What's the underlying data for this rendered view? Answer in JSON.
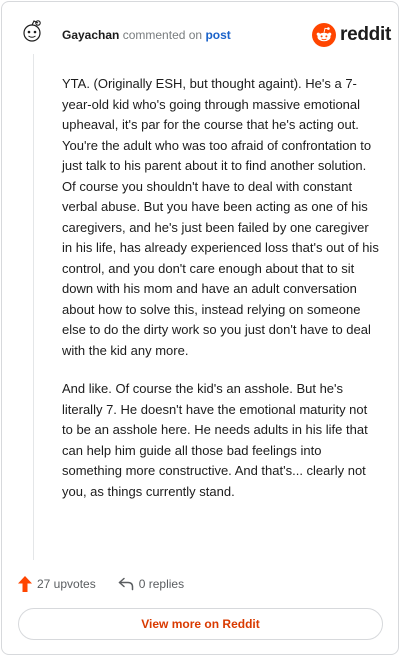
{
  "comment": {
    "username": "Gayachan",
    "commented_text": "commented on",
    "post_link": "post",
    "paragraphs": [
      "YTA. (Originally ESH, but thought againt). He's a 7-year-old kid who's going through massive emotional upheaval, it's par for the course that he's acting out. You're the adult who was too afraid of confrontation to just talk to his parent about it to find another solution. Of course you shouldn't have to deal with constant verbal abuse. But you have been acting as one of his caregivers, and he's just been failed by one caregiver in his life, has already experienced loss that's out of his control, and you don't care enough about that to sit down with his mom and have an adult conversation about how to solve this, instead relying on someone else to do the dirty work so you just don't have to deal with the kid any more.",
      "And like. Of course the kid's an asshole. But he's literally 7. He doesn't have the emotional maturity not to be an asshole here. He needs adults in his life that can help him guide all those bad feelings into something more constructive. And that's... clearly not you, as things currently stand."
    ]
  },
  "brand": {
    "name": "reddit",
    "color": "#ff4500"
  },
  "actions": {
    "upvotes_label": "27 upvotes",
    "replies_label": "0 replies",
    "upvote_color": "#ff4500"
  },
  "footer": {
    "view_more_label": "View more on Reddit",
    "accent": "#d93a00"
  },
  "icons": [
    "avatar-snoo-icon",
    "reddit-logo-icon",
    "upvote-arrow-icon",
    "reply-arrow-icon"
  ]
}
